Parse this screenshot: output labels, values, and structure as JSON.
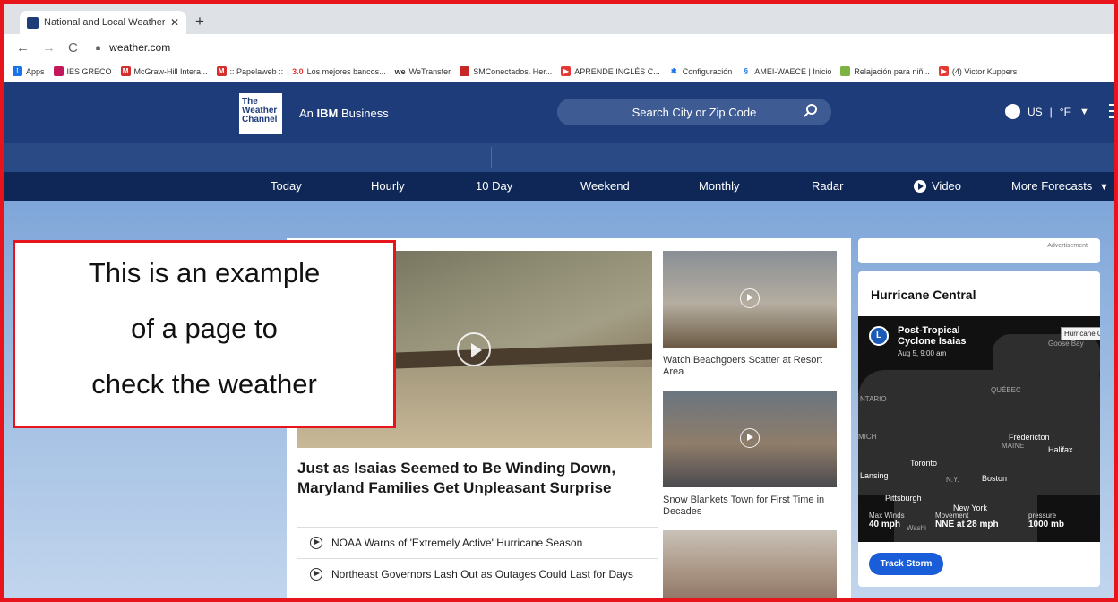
{
  "browser": {
    "tab_title": "National and Local Weather Rad",
    "url": "weather.com",
    "bookmarks": [
      {
        "label": "Apps",
        "color": "#1a73e8"
      },
      {
        "label": "IES GRECO",
        "color": "#c2185b"
      },
      {
        "label": "McGraw-Hill Intera...",
        "color": "#d32f2f"
      },
      {
        "label": ":: Papelaweb ::",
        "color": "#d32f2f"
      },
      {
        "label": "Los mejores bancos...",
        "color": "#e53935"
      },
      {
        "label": "WeTransfer",
        "color": "#222222"
      },
      {
        "label": "SMConectados. Her...",
        "color": "#c62828"
      },
      {
        "label": "APRENDE INGLÉS C...",
        "color": "#e53935"
      },
      {
        "label": "Configuración",
        "color": "#1a73e8"
      },
      {
        "label": "AMEI-WAECE | Inicio",
        "color": "#1a73e8"
      },
      {
        "label": "Relajación para niñ...",
        "color": "#7cb342"
      },
      {
        "label": "(4) Victor Kuppers",
        "color": "#e53935"
      }
    ],
    "bookmark_prefix_30": "3.0"
  },
  "header": {
    "logo_lines": [
      "The",
      "Weather",
      "Channel"
    ],
    "ibm_prefix": "An ",
    "ibm_brand": "IBM",
    "ibm_suffix": " Business",
    "search_placeholder": "Search City or Zip Code",
    "region": "US",
    "unit": "°F"
  },
  "nav": [
    "Today",
    "Hourly",
    "10 Day",
    "Weekend",
    "Monthly",
    "Radar",
    "Video",
    "More Forecasts"
  ],
  "main": {
    "headline": "Just as Isaias Seemed to Be Winding Down, Maryland Families Get Unpleasant Surprise",
    "related": [
      "NOAA Warns of 'Extremely Active' Hurricane Season",
      "Northeast Governors Lash Out as Outages Could Last for Days"
    ],
    "side_stories": [
      "Watch Beachgoers Scatter at Resort Area",
      "Snow Blankets Town for First Time in Decades"
    ]
  },
  "right": {
    "ad_label": "Advertisement",
    "hc_title": "Hurricane Central",
    "storm_icon": "L",
    "storm_name_1": "Post-Tropical",
    "storm_name_2": "Cyclone Isaias",
    "storm_date": "Aug 5, 9:00 am",
    "tooltip": "Hurricane Cen",
    "map_labels": [
      "Goose Bay",
      "NTARIO",
      "QUÉBEC",
      "MAINE",
      "Fredericton",
      "Halifax",
      "Toronto",
      "Lansing",
      "N.Y.",
      "Boston",
      "Pittsburgh",
      "New York",
      "Washi",
      "MICH"
    ],
    "stats": [
      {
        "k": "Max Winds",
        "v": "40 mph"
      },
      {
        "k": "Movement",
        "v": "NNE at 28 mph"
      },
      {
        "k": "pressure",
        "v": "1000 mb"
      }
    ],
    "track_button": "Track Storm"
  },
  "annotation": {
    "lines": [
      "This is an example",
      "of a page to",
      "check the weather"
    ]
  }
}
